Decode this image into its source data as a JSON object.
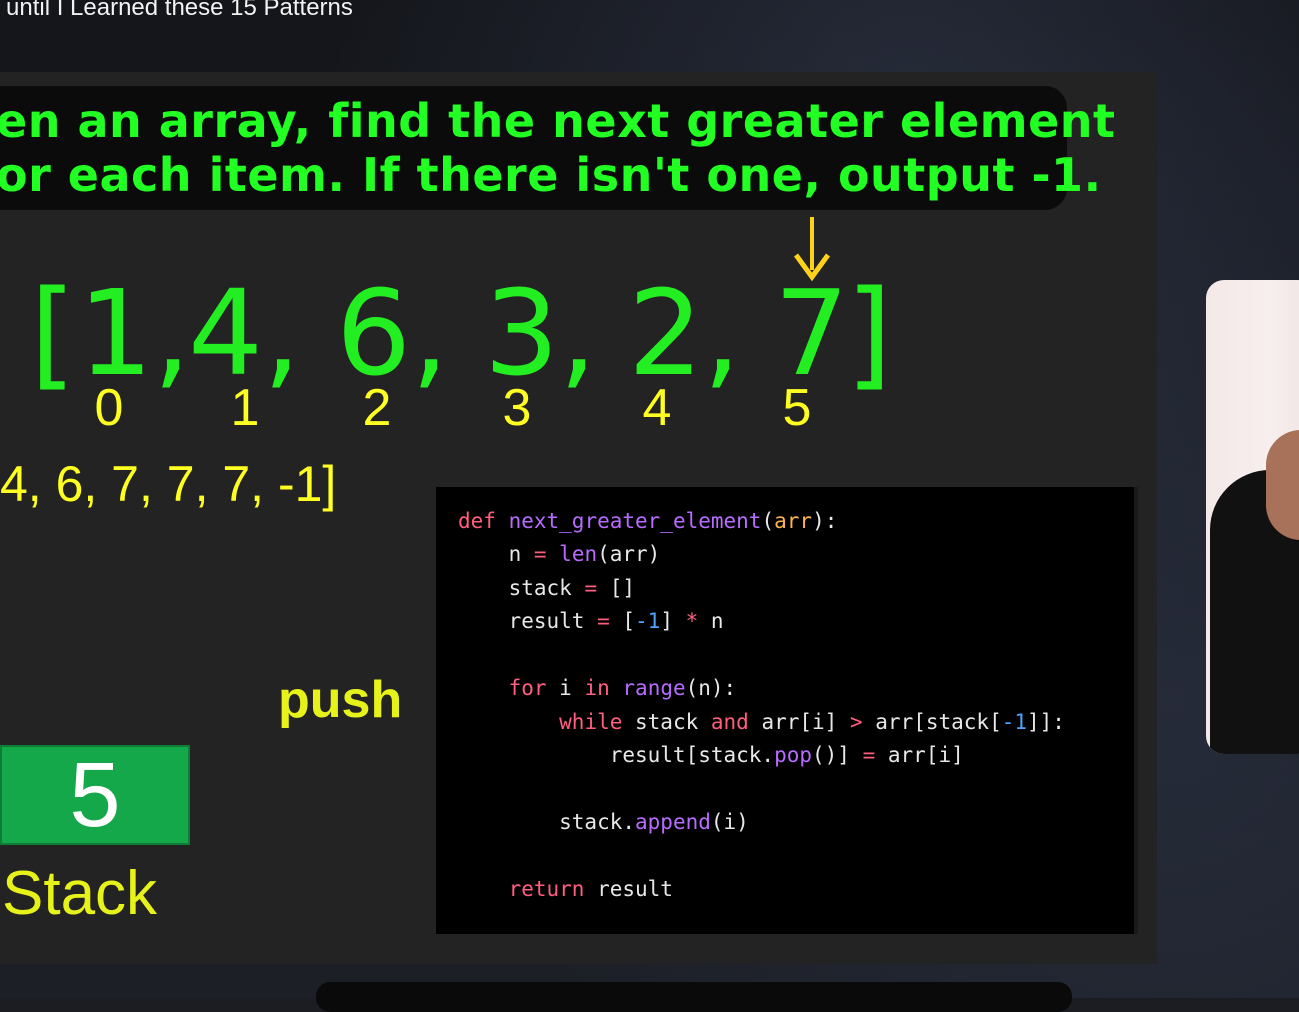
{
  "header": {
    "title": "until I Learned these 15 Patterns"
  },
  "prompt": {
    "line1": "en an array, find the next greater element",
    "line2": "or each item. If there isn't one, output -1."
  },
  "array": {
    "open": "[",
    "items": [
      "1,",
      "4,",
      "6,",
      "3,",
      "2,",
      "7"
    ],
    "close": "]",
    "indices": [
      "0",
      "1",
      "2",
      "3",
      "4",
      "5"
    ]
  },
  "result_text": "4, 6, 7, 7, 7, -1]",
  "operation": "push",
  "stack": {
    "top_value": "5",
    "label": "Stack"
  },
  "code": {
    "def": "def",
    "func_name": "next_greater_element",
    "param": "arr",
    "len": "len",
    "range": "range",
    "pop": "pop",
    "append": "append",
    "kw_for": "for",
    "kw_in": "in",
    "kw_while": "while",
    "kw_and": "and",
    "kw_return": "return",
    "num_neg1": "-1",
    "num_neg1b": "-1"
  },
  "colors": {
    "prompt_green": "#22ff22",
    "array_green": "#22ee22",
    "index_yellow": "#ffff22",
    "stack_green": "#14a84a",
    "arrow_yellow": "#ffd21a"
  }
}
